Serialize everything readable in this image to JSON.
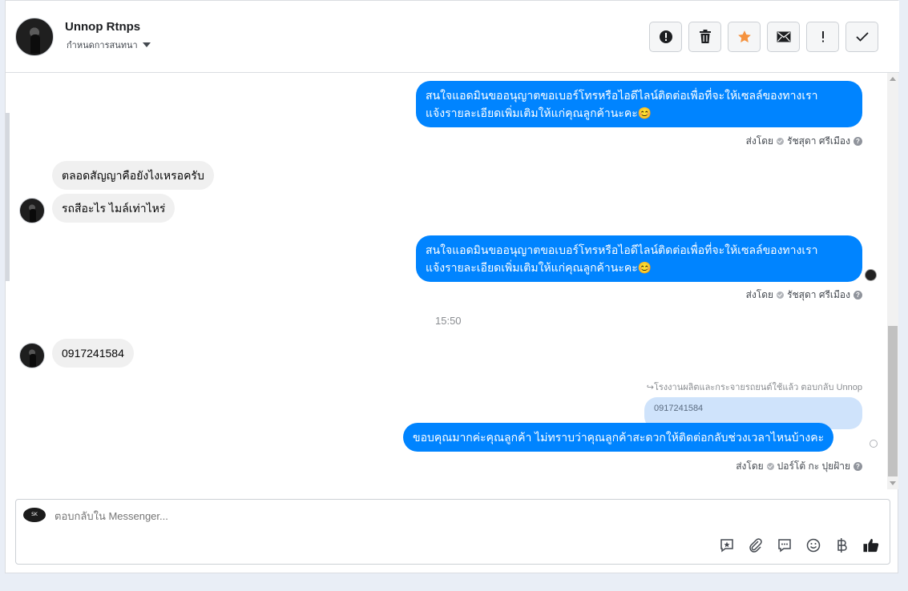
{
  "header": {
    "contact_name": "Unnop Rtnps",
    "assign_label": "กำหนดการสนทนา",
    "actions": [
      {
        "icon": "alert-circle-icon",
        "label": "mark-spam"
      },
      {
        "icon": "trash-icon",
        "label": "delete"
      },
      {
        "icon": "star-icon",
        "label": "star"
      },
      {
        "icon": "envelope-icon",
        "label": "mark-unread"
      },
      {
        "icon": "exclamation-icon",
        "label": "follow-up"
      },
      {
        "icon": "check-icon",
        "label": "done"
      }
    ],
    "accent_star": "#f5923e"
  },
  "messages": {
    "out1_text": "สนใจแอดมินขออนุญาตขอเบอร์โทรหรือไอดีไลน์ติดต่อเพื่อที่จะให้เซลล์ของทางเรา\nแจ้งรายละเอียดเพิ่มเติมให้แก่คุณลูกค้านะคะ😊",
    "out1_sent_prefix": "ส่งโดย",
    "out1_sender": "รัชสุดา ศรีเมือง",
    "in1_text": "ตลอดสัญญาคือยังไงเหรอครับ",
    "in2_text": "รถสีอะไร ไมล์เท่าไหร่",
    "out2_text": "สนใจแอดมินขออนุญาตขอเบอร์โทรหรือไอดีไลน์ติดต่อเพื่อที่จะให้เซลล์ของทางเรา\nแจ้งรายละเอียดเพิ่มเติมให้แก่คุณลูกค้านะคะ😊",
    "out2_sent_prefix": "ส่งโดย",
    "out2_sender": "รัชสุดา ศรีเมือง",
    "time_separator": "15:50",
    "in3_text": "0917241584",
    "reply_note": "โรงงานผลิตและกระจายรถยนต์ใช้แล้ว ตอบกลับ Unnop",
    "quoted_text": "0917241584",
    "out3_text": "ขอบคุณมากค่ะคุณลูกค้า ไม่ทราบว่าคุณลูกค้าสะดวกให้ติดต่อกลับช่วงเวลาไหนบ้างคะ",
    "out3_sent_prefix": "ส่งโดย",
    "out3_sender": "ปอร์โต้ กะ ปุยฝ้าย",
    "colors": {
      "outgoing": "#0084ff",
      "incoming": "#f0f0f0"
    }
  },
  "composer": {
    "placeholder": "ตอบกลับใน Messenger...",
    "page_logo_text": "SK",
    "tools": [
      "saved-reply-icon",
      "attachment-icon",
      "chat-bubble-icon",
      "emoji-icon",
      "baht-icon",
      "thumbs-up-icon"
    ]
  }
}
